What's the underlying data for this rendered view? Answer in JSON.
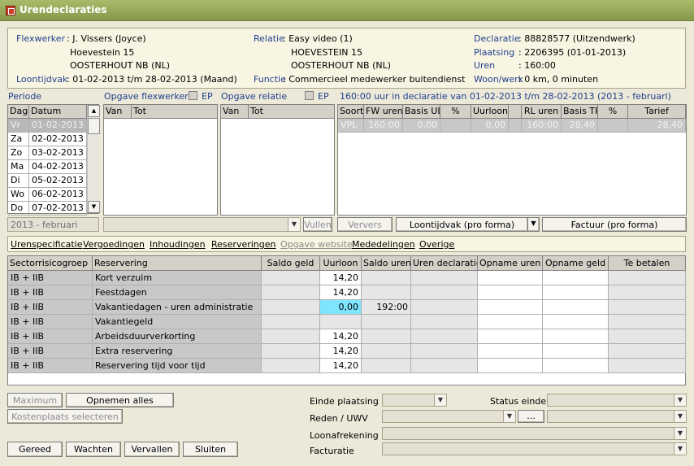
{
  "window": {
    "title": "Urendeclaraties"
  },
  "info": {
    "flexwerker_label": "Flexwerker",
    "flexwerker_lines": [
      ": J. Vissers (Joyce)",
      "Hoevestein 15",
      "OOSTERHOUT NB (NL)"
    ],
    "loontijdvak_label": "Loontijdvak",
    "loontijdvak_value": ": 01-02-2013 t/m 28-02-2013 (Maand)",
    "relatie_label": "Relatie",
    "relatie_lines": [
      ": Easy video (1)",
      "HOEVESTEIN 15",
      "OOSTERHOUT NB (NL)"
    ],
    "functie_label": "Functie",
    "functie_value": ": Commercieel medewerker buitendienst",
    "declaratie_label": "Declaratie",
    "declaratie_value": ": 88828577 (Uitzendwerk)",
    "plaatsing_label": "Plaatsing",
    "plaatsing_value": ": 2206395   (01-01-2013)",
    "uren_label": "Uren",
    "uren_value": ": 160:00",
    "woonwerk_label": "Woon/werk",
    "woonwerk_value": ": 0 km, 0 minuten"
  },
  "periode": {
    "label": "Periode",
    "headers": [
      "Dag",
      "Datum"
    ],
    "rows": [
      {
        "dag": "Vr",
        "datum": "01-02-2013"
      },
      {
        "dag": "Za",
        "datum": "02-02-2013"
      },
      {
        "dag": "Zo",
        "datum": "03-02-2013"
      },
      {
        "dag": "Ma",
        "datum": "04-02-2013"
      },
      {
        "dag": "Di",
        "datum": "05-02-2013"
      },
      {
        "dag": "Wo",
        "datum": "06-02-2013"
      },
      {
        "dag": "Do",
        "datum": "07-02-2013"
      }
    ],
    "combo_value": "2013 - februari"
  },
  "opgave_flexwerker": {
    "label": "Opgave flexwerker",
    "ep": "EP",
    "headers": [
      "Van",
      "Tot"
    ]
  },
  "opgave_relatie": {
    "label": "Opgave relatie",
    "ep": "EP",
    "headers": [
      "Van",
      "Tot"
    ]
  },
  "vullen_button": "Vullen",
  "declaratie": {
    "summary": "160:00 uur in declaratie van 01-02-2013 t/m 28-02-2013 (2013 - februari)",
    "headers": [
      "Soort",
      "FW uren",
      "Basis UL",
      "%",
      "Uurloon",
      "",
      "RL uren",
      "Basis TR",
      "%",
      "Tarief"
    ],
    "rows": [
      {
        "soort": "VPL",
        "fw_uren": "160:00",
        "basis_ul": "0,00",
        "pct1": "",
        "uurloon": "0,00",
        "blank": "",
        "rl_uren": "160:00",
        "basis_tr": "28,40",
        "pct2": "",
        "tarief": "28,40"
      }
    ]
  },
  "actions": {
    "verversen": "Ververs",
    "loontijdvak": "Loontijdvak (pro forma)",
    "factuur": "Factuur (pro forma)"
  },
  "tabs": [
    {
      "label": "Urenspecificatie",
      "enabled": true
    },
    {
      "label": "Vergoedingen",
      "enabled": true
    },
    {
      "label": "Inhoudingen",
      "enabled": true
    },
    {
      "label": "Reserveringen",
      "enabled": true
    },
    {
      "label": "Opgave website",
      "enabled": false
    },
    {
      "label": "Mededelingen",
      "enabled": true
    },
    {
      "label": "Overige",
      "enabled": true
    }
  ],
  "reserveringen": {
    "headers": [
      "Sectorrisicogroep",
      "Reservering",
      "Saldo geld",
      "Uurloon",
      "Saldo uren",
      "Uren declaratie",
      "Opname uren",
      "Opname geld",
      "Te betalen"
    ],
    "rows": [
      {
        "groep": "IB + IIB",
        "reservering": "Kort verzuim",
        "saldo_geld": "",
        "uurloon": "14,20",
        "saldo_uren": "",
        "uren_decl": "",
        "opname_uren": "",
        "opname_geld": "",
        "te_betalen": ""
      },
      {
        "groep": "IB + IIB",
        "reservering": "Feestdagen",
        "saldo_geld": "",
        "uurloon": "14,20",
        "saldo_uren": "",
        "uren_decl": "",
        "opname_uren": "",
        "opname_geld": "",
        "te_betalen": ""
      },
      {
        "groep": "IB + IIB",
        "reservering": "Vakantiedagen - uren administratie",
        "saldo_geld": "",
        "uurloon": "0,00",
        "saldo_uren": "192:00",
        "uren_decl": "",
        "opname_uren": "",
        "opname_geld": "",
        "te_betalen": ""
      },
      {
        "groep": "IB + IIB",
        "reservering": "Vakantiegeld",
        "saldo_geld": "",
        "uurloon": "",
        "saldo_uren": "",
        "uren_decl": "",
        "opname_uren": "",
        "opname_geld": "",
        "te_betalen": ""
      },
      {
        "groep": "IB + IIB",
        "reservering": "Arbeidsduurverkorting",
        "saldo_geld": "",
        "uurloon": "14,20",
        "saldo_uren": "",
        "uren_decl": "",
        "opname_uren": "",
        "opname_geld": "",
        "te_betalen": ""
      },
      {
        "groep": "IB + IIB",
        "reservering": "Extra reservering",
        "saldo_geld": "",
        "uurloon": "14,20",
        "saldo_uren": "",
        "uren_decl": "",
        "opname_uren": "",
        "opname_geld": "",
        "te_betalen": ""
      },
      {
        "groep": "IB + IIB",
        "reservering": "Reservering tijd voor tijd",
        "saldo_geld": "",
        "uurloon": "14,20",
        "saldo_uren": "",
        "uren_decl": "",
        "opname_uren": "",
        "opname_geld": "",
        "te_betalen": ""
      }
    ]
  },
  "bottom": {
    "maximum": "Maximum",
    "opnemen_alles": "Opnemen alles",
    "kostenplaats": "Kostenplaats selecteren",
    "gereed": "Gereed",
    "wachten": "Wachten",
    "vervallen": "Vervallen",
    "sluiten": "Sluiten",
    "einde_plaatsing": "Einde plaatsing",
    "status_einde": "Status einde",
    "reden_uwv": "Reden / UWV",
    "ellipsis": "...",
    "loonafrekening": "Loonafrekening",
    "facturatie": "Facturatie"
  },
  "colors": {
    "titlebar": "#879a4c",
    "label_blue": "#1f3f8f",
    "highlight_cyan": "#7fe5ff"
  }
}
